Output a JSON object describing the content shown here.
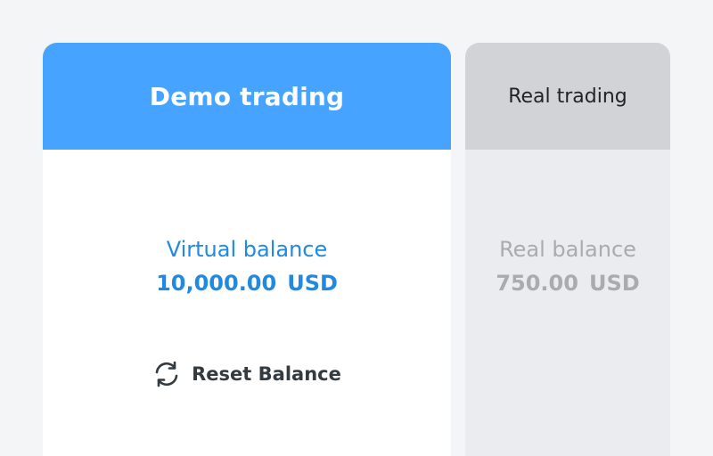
{
  "demo": {
    "title": "Demo trading",
    "balance_label": "Virtual balance",
    "balance_amount": "10,000.00",
    "currency": "USD",
    "reset_label": "Reset Balance",
    "reset_icon": "refresh-icon"
  },
  "real": {
    "title": "Real trading",
    "balance_label": "Real balance",
    "balance_amount": "750.00",
    "currency": "USD"
  },
  "colors": {
    "accent": "#46a3ff",
    "accent_text": "#2189e0",
    "muted_text": "#a9abb0",
    "real_header": "#d2d3d7",
    "real_body": "#ebecef",
    "page_bg": "#f4f5f7"
  }
}
